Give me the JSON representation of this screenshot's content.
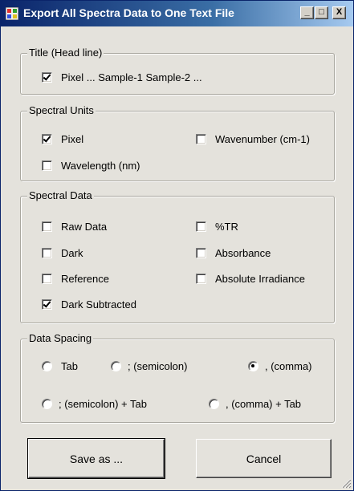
{
  "window": {
    "title": "Export All Spectra Data to One Text File",
    "minimize_glyph": "_",
    "maximize_glyph": "□",
    "close_glyph": "X",
    "title_color": "#0a246a"
  },
  "title_group": {
    "label": "Title (Head line)",
    "option": {
      "label": "Pixel ... Sample-1  Sample-2  ...",
      "checked": true
    }
  },
  "units_group": {
    "label": "Spectral Units",
    "options": [
      {
        "label": "Pixel",
        "checked": true
      },
      {
        "label": "Wavenumber (cm-1)",
        "checked": false
      },
      {
        "label": "Wavelength (nm)",
        "checked": false
      }
    ]
  },
  "data_group": {
    "label": "Spectral Data",
    "options": [
      {
        "label": "Raw Data",
        "checked": false
      },
      {
        "label": "%TR",
        "checked": false
      },
      {
        "label": "Dark",
        "checked": false
      },
      {
        "label": "Absorbance",
        "checked": false
      },
      {
        "label": "Reference",
        "checked": false
      },
      {
        "label": "Absolute Irradiance",
        "checked": false
      },
      {
        "label": "Dark Subtracted",
        "checked": true
      }
    ]
  },
  "spacing_group": {
    "label": "Data Spacing",
    "options": [
      {
        "label": "Tab",
        "selected": false
      },
      {
        "label": "; (semicolon)",
        "selected": false
      },
      {
        "label": ", (comma)",
        "selected": true
      },
      {
        "label": "; (semicolon) + Tab",
        "selected": false
      },
      {
        "label": ", (comma) + Tab",
        "selected": false
      }
    ]
  },
  "buttons": {
    "save_as": "Save as ...",
    "cancel": "Cancel"
  }
}
